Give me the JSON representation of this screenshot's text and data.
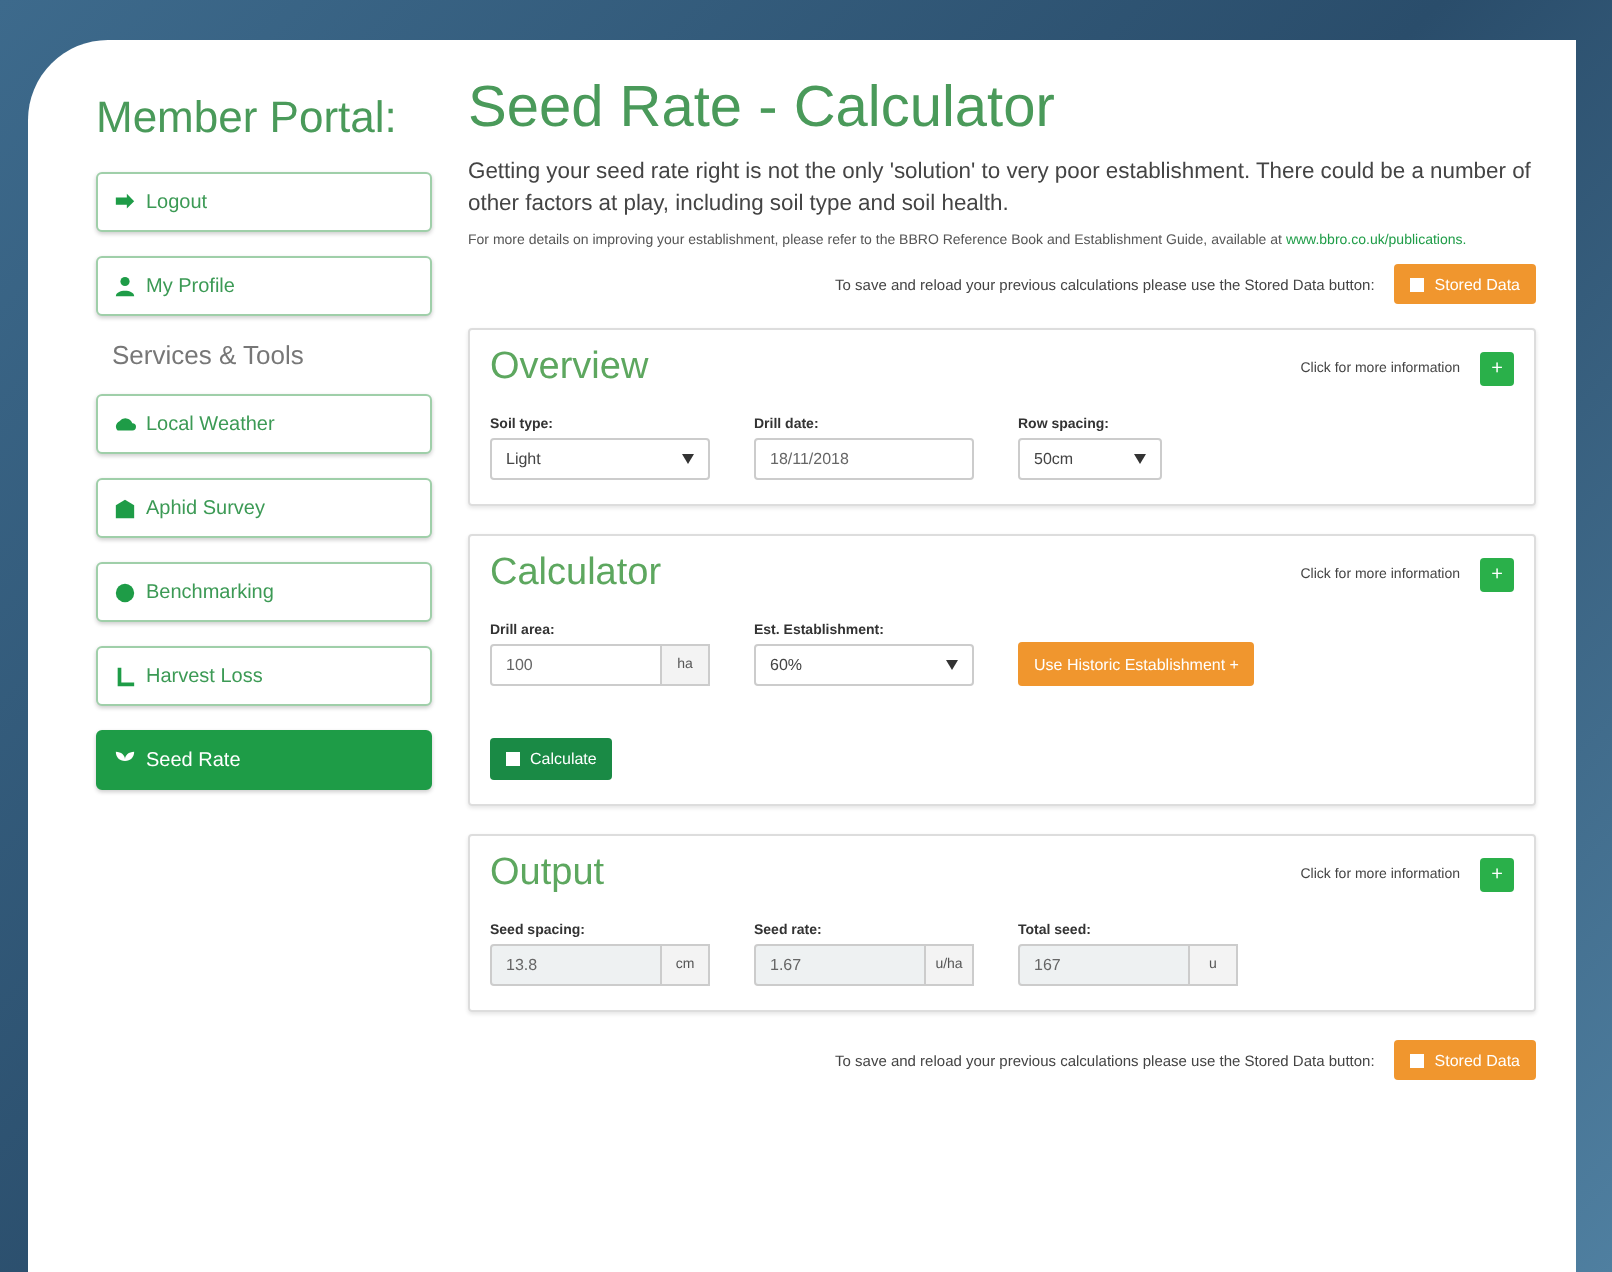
{
  "sidebar": {
    "title": "Member Portal:",
    "account_items": [
      {
        "label": "Logout",
        "selected": false
      },
      {
        "label": "My Profile",
        "selected": false
      }
    ],
    "section_title": "Services & Tools",
    "tool_items": [
      {
        "label": "Local Weather",
        "selected": false
      },
      {
        "label": "Aphid Survey",
        "selected": false
      },
      {
        "label": "Benchmarking",
        "selected": false
      },
      {
        "label": "Harvest Loss",
        "selected": false
      },
      {
        "label": "Seed Rate",
        "selected": true
      }
    ]
  },
  "page_title": "Seed Rate - Calculator",
  "intro": "Getting your seed rate right is not the only 'solution' to very poor establishment. There could be a number of other factors at play, including soil type and soil health.",
  "note": {
    "text": "For more details on improving your establishment, please refer to the BBRO Reference Book and Establishment Guide, available at ",
    "link": "www.bbro.co.uk/publications."
  },
  "stored_top": {
    "text": "To save and reload your previous calculations please use the Stored Data button:",
    "button": "Stored Data"
  },
  "panels": [
    {
      "title": "Overview",
      "info": "Click for more information",
      "info_button": "+",
      "fields": [
        {
          "kind": "select",
          "label": "Soil type:",
          "value": "Light"
        },
        {
          "kind": "input",
          "label": "Drill date:",
          "value": "18/11/2018"
        },
        {
          "kind": "select",
          "label": "Row spacing:",
          "value": "50cm"
        }
      ]
    },
    {
      "title": "Calculator",
      "info": "Click for more information",
      "info_button": "+",
      "fields": [
        {
          "kind": "unit",
          "label": "Drill area:",
          "value": "100",
          "unit": "ha"
        },
        {
          "kind": "select",
          "label": "Est. Establishment:",
          "value": "60%"
        }
      ],
      "side_button": "Use Historic Establishment +",
      "action": "Calculate"
    },
    {
      "title": "Output",
      "info": "Click for more information",
      "info_button": "+",
      "fields": [
        {
          "kind": "readonly",
          "label": "Seed spacing:",
          "value": "13.8",
          "unit": "cm"
        },
        {
          "kind": "readonly",
          "label": "Seed rate:",
          "value": "1.67",
          "unit": "u/ha"
        },
        {
          "kind": "readonly",
          "label": "Total seed:",
          "value": "167",
          "unit": "u"
        }
      ]
    }
  ],
  "stored_bottom": {
    "text": "To save and reload your previous calculations please use the Stored Data button:",
    "button": "Stored Data"
  }
}
